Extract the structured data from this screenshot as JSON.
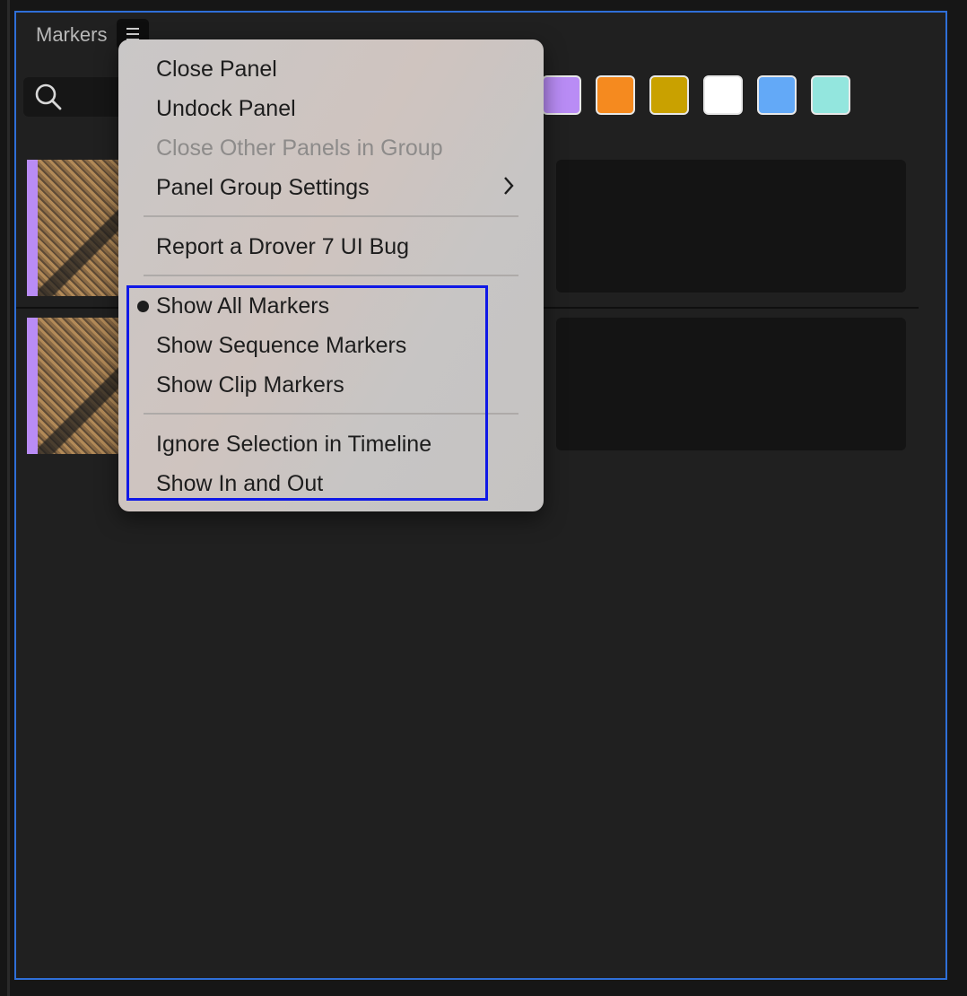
{
  "panel": {
    "title": "Markers"
  },
  "swatches": {
    "colors": [
      "#b98cf5",
      "#f58a1f",
      "#c9a100",
      "#ffffff",
      "#63a9f7",
      "#93e6de"
    ]
  },
  "marker_rows": {
    "stripe_color": "#b98cf5"
  },
  "context_menu": {
    "close_panel": "Close Panel",
    "undock_panel": "Undock Panel",
    "close_other_panels": "Close Other Panels in Group",
    "panel_group_settings": "Panel Group Settings",
    "report_bug": "Report a Drover 7 UI Bug",
    "show_all_markers": "Show All Markers",
    "show_sequence_markers": "Show Sequence Markers",
    "show_clip_markers": "Show Clip Markers",
    "ignore_selection": "Ignore Selection in Timeline",
    "show_in_out": "Show In and Out",
    "selected_item": "Show All Markers"
  }
}
